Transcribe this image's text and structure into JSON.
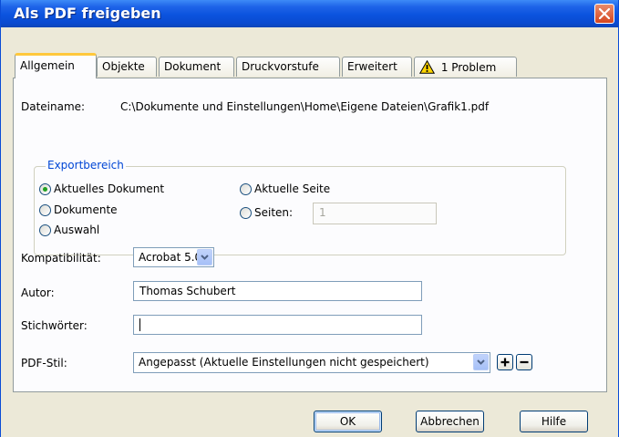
{
  "window": {
    "title": "Als PDF freigeben"
  },
  "tabs": [
    {
      "label": "Allgemein",
      "active": true
    },
    {
      "label": "Objekte"
    },
    {
      "label": "Dokument"
    },
    {
      "label": "Druckvorstufe"
    },
    {
      "label": "Erweitert"
    },
    {
      "label": "1 Problem",
      "icon": "warning-icon"
    }
  ],
  "general": {
    "filename_label": "Dateiname:",
    "filename_value": "C:\\Dokumente und Einstellungen\\Home\\Eigene Dateien\\Grafik1.pdf",
    "export_group": {
      "legend": "Exportbereich",
      "options": {
        "current_document": "Aktuelles Dokument",
        "documents": "Dokumente",
        "selection": "Auswahl",
        "current_page": "Aktuelle Seite",
        "pages": "Seiten:"
      },
      "selected": "current_document",
      "pages_value": "1"
    },
    "compat_label": "Kompatibilität:",
    "compat_value": "Acrobat 5.0",
    "author_label": "Autor:",
    "author_value": "Thomas Schubert",
    "keywords_label": "Stichwörter:",
    "keywords_value": "",
    "style_label": "PDF-Stil:",
    "style_value": "Angepasst (Aktuelle Einstellungen nicht gespeichert)"
  },
  "buttons": {
    "ok": "OK",
    "cancel": "Abbrechen",
    "help": "Hilfe"
  },
  "colors": {
    "titlebar": "#0a4ad0",
    "tab_highlight": "#ffc83c",
    "group_legend": "#0046d5",
    "close": "#d5461f"
  }
}
